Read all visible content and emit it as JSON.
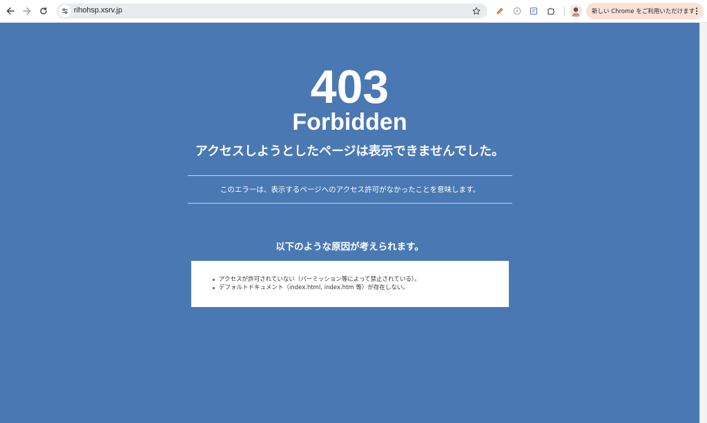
{
  "browser": {
    "url": "rihohsp.xsrv.jp",
    "promo_label": "新しい Chrome をご利用いただけます",
    "icons": {
      "back": "arrow-left-icon",
      "forward": "arrow-right-icon",
      "reload": "reload-icon",
      "site_info": "tune-icon",
      "bookmark": "star-icon",
      "extension1": "pen-icon",
      "extension2": "compass-icon",
      "extension3": "notes-icon",
      "extensions": "puzzle-icon",
      "menu": "kebab-icon"
    }
  },
  "page": {
    "background_color": "#4a78b3",
    "code": "403",
    "status": "Forbidden",
    "headline": "アクセスしようとしたページは表示できませんでした。",
    "explanation": "このエラーは、表示するページへのアクセス許可がなかったことを意味します。",
    "causes_title": "以下のような原因が考えられます。",
    "causes": [
      "アクセスが許可されていない（パーミッション等によって禁止されている）。",
      "デフォルトドキュメント（index.html, index.htm 等）が存在しない。"
    ]
  }
}
